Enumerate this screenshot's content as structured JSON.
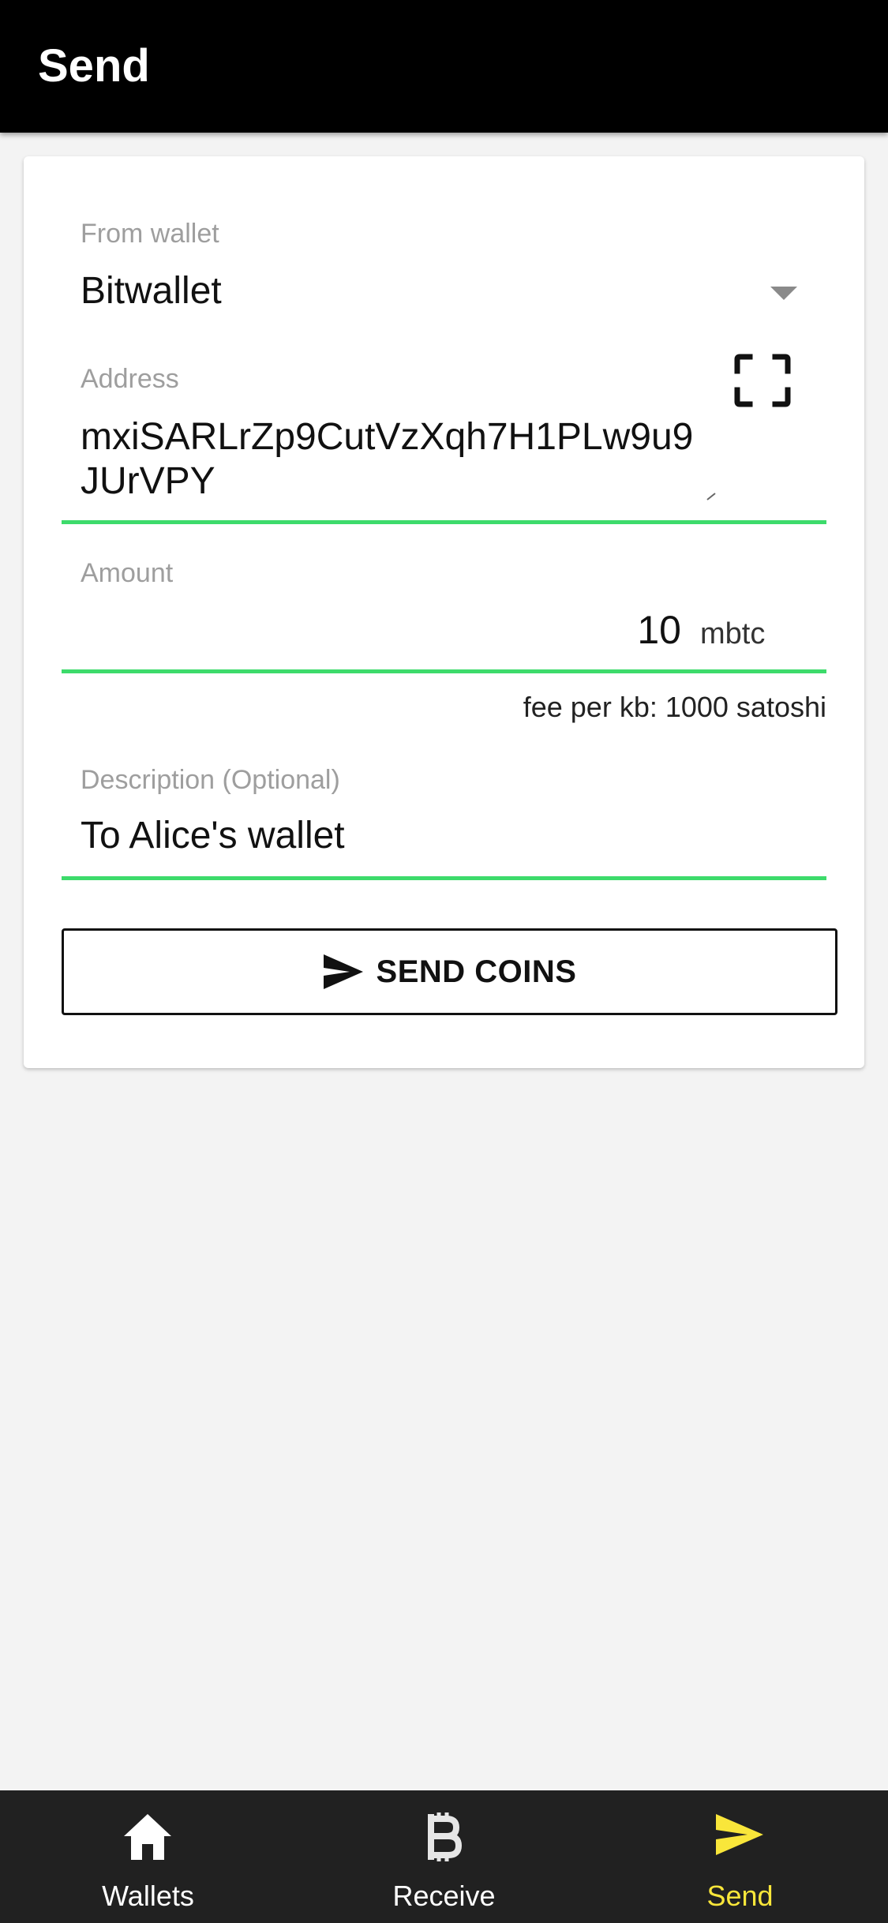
{
  "app_bar": {
    "title": "Send"
  },
  "form": {
    "wallet": {
      "label": "From wallet",
      "value": "Bitwallet"
    },
    "address": {
      "label": "Address",
      "value": "mxiSARLrZp9CutVzXqh7H1PLw9u9JUrVPY"
    },
    "amount": {
      "label": "Amount",
      "value": "10",
      "unit": "mbtc"
    },
    "fee": {
      "text": "fee per kb: 1000 satoshi"
    },
    "description": {
      "label": "Description (Optional)",
      "value": "To Alice's wallet"
    },
    "send_button": {
      "label": "SEND COINS"
    }
  },
  "bottom_nav": {
    "items": [
      {
        "label": "Wallets",
        "icon": "home-icon",
        "active": false
      },
      {
        "label": "Receive",
        "icon": "bitcoin-icon",
        "active": false
      },
      {
        "label": "Send",
        "icon": "send-icon",
        "active": true
      }
    ]
  },
  "colors": {
    "app_bar": "#000000",
    "background": "#f3f3f3",
    "underline_accent": "#3ddb6b",
    "nav_background": "#212121",
    "nav_active": "#f9e63a",
    "nav_inactive": "#ffffff"
  }
}
